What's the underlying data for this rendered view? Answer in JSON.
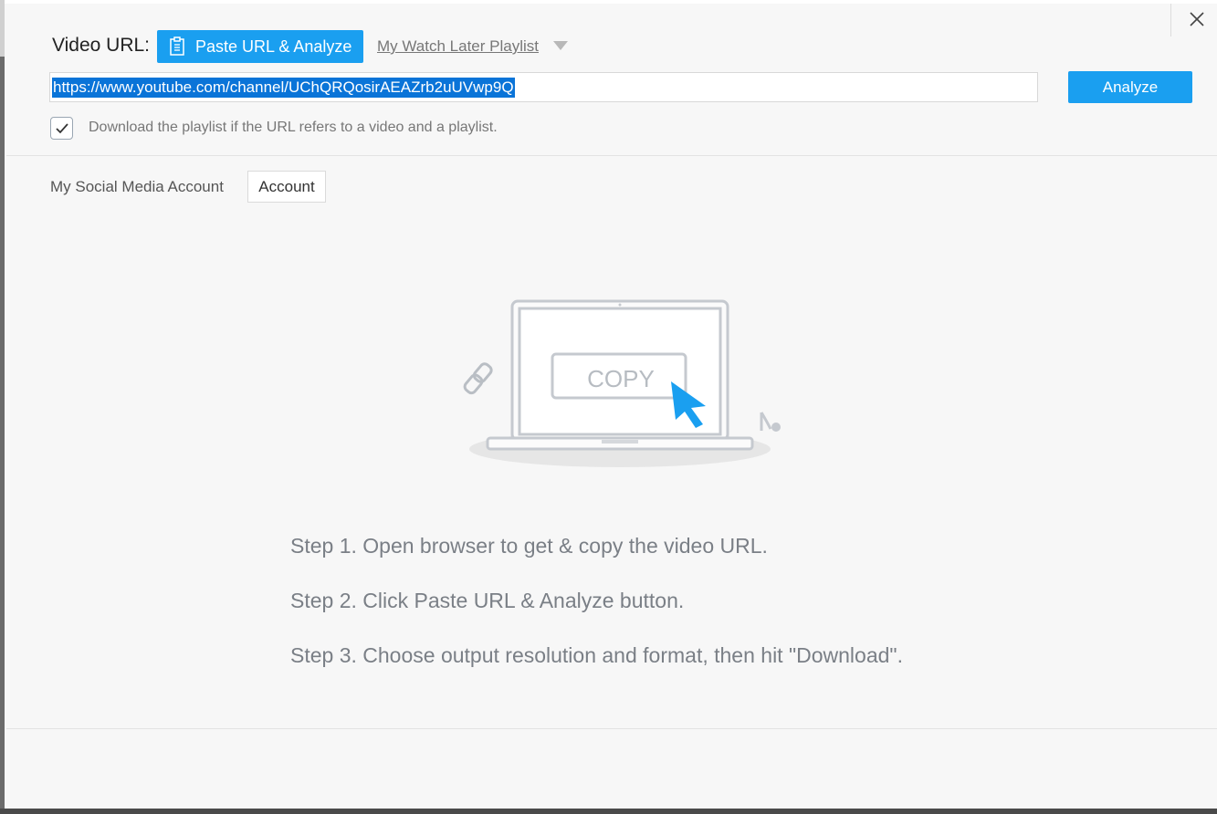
{
  "header": {
    "video_url_label": "Video URL:",
    "paste_button_label": "Paste URL & Analyze",
    "watch_later_label": "My Watch Later Playlist"
  },
  "url_input": {
    "value": "https://www.youtube.com/channel/UChQRQosirAEAZrb2uUVwp9Q"
  },
  "analyze_button_label": "Analyze",
  "playlist_option": {
    "checked": true,
    "label": "Download the playlist if the URL refers to a video and a playlist."
  },
  "social": {
    "label": "My Social Media Account",
    "account_button_label": "Account"
  },
  "illustration": {
    "copy_label": "COPY"
  },
  "steps": [
    "Step 1. Open browser to get & copy the video URL.",
    "Step 2. Click Paste URL & Analyze button.",
    "Step 3. Choose output resolution and format, then hit \"Download\"."
  ],
  "colors": {
    "accent": "#1a9ff0",
    "selection": "#0a74d8",
    "background": "#f7f7f7"
  },
  "icons": [
    "close-icon",
    "clipboard-icon",
    "triangle-down-icon",
    "checkmark-icon",
    "link-icon",
    "laptop-icon",
    "cursor-icon",
    "music-note-icon"
  ]
}
